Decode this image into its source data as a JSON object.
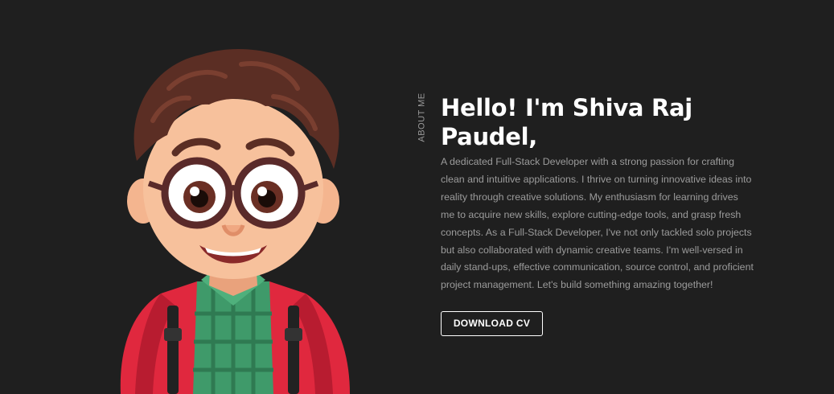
{
  "about": {
    "section_label": "ABOUT ME",
    "heading": "Hello! I'm Shiva Raj Paudel,",
    "bio": "A dedicated Full-Stack Developer with a strong passion for crafting clean and intuitive applications. I thrive on turning innovative ideas into reality through creative solutions. My enthusiasm for learning drives me to acquire new skills, explore cutting-edge tools, and grasp fresh concepts. As a Full-Stack Developer, I've not only tackled solo projects but also collaborated with dynamic creative teams. I'm well-versed in daily stand-ups, effective communication, source control, and proficient project management. Let's build something amazing together!",
    "cv_button_label": "DOWNLOAD CV"
  },
  "colors": {
    "background": "#1f1f1f",
    "heading": "#ffffff",
    "body_text": "#9b9b9b",
    "jacket": "#e0283e",
    "shirt": "#3f9a6a",
    "hair": "#5b2e24"
  }
}
